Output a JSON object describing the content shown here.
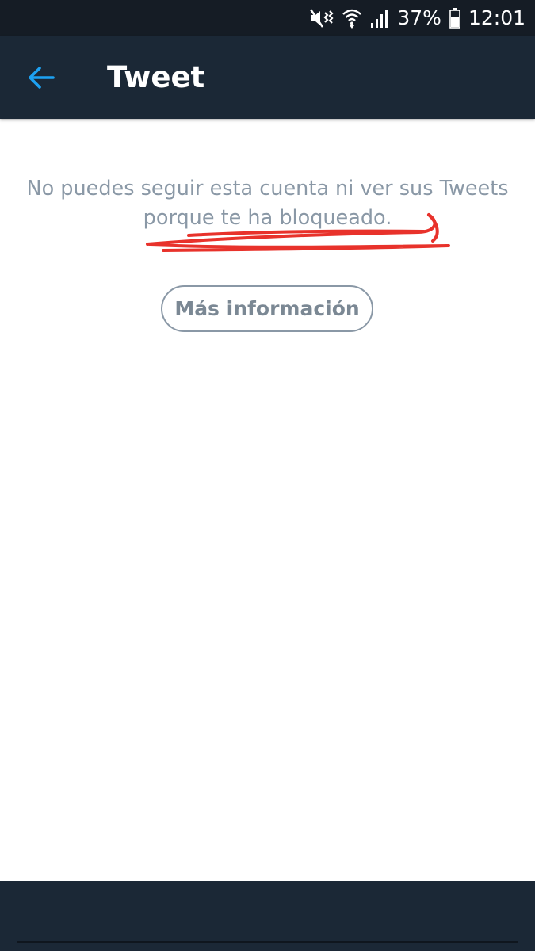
{
  "status_bar": {
    "battery": "37%",
    "time": "12:01",
    "icons": [
      "mute-vibrate-icon",
      "wifi-icon",
      "signal-icon",
      "battery-icon"
    ]
  },
  "app_bar": {
    "title": "Tweet",
    "back_icon": "back-arrow-icon"
  },
  "content": {
    "message_line1": "No puedes seguir esta cuenta ni ver sus Tweets",
    "message_line2": "porque te ha bloqueado.",
    "more_info_label": "Más información"
  },
  "colors": {
    "status_bar": "#151c25",
    "app_bar": "#1b2836",
    "accent": "#1da1f2",
    "text_muted": "#8a98a6",
    "annotation": "#e8322b"
  }
}
